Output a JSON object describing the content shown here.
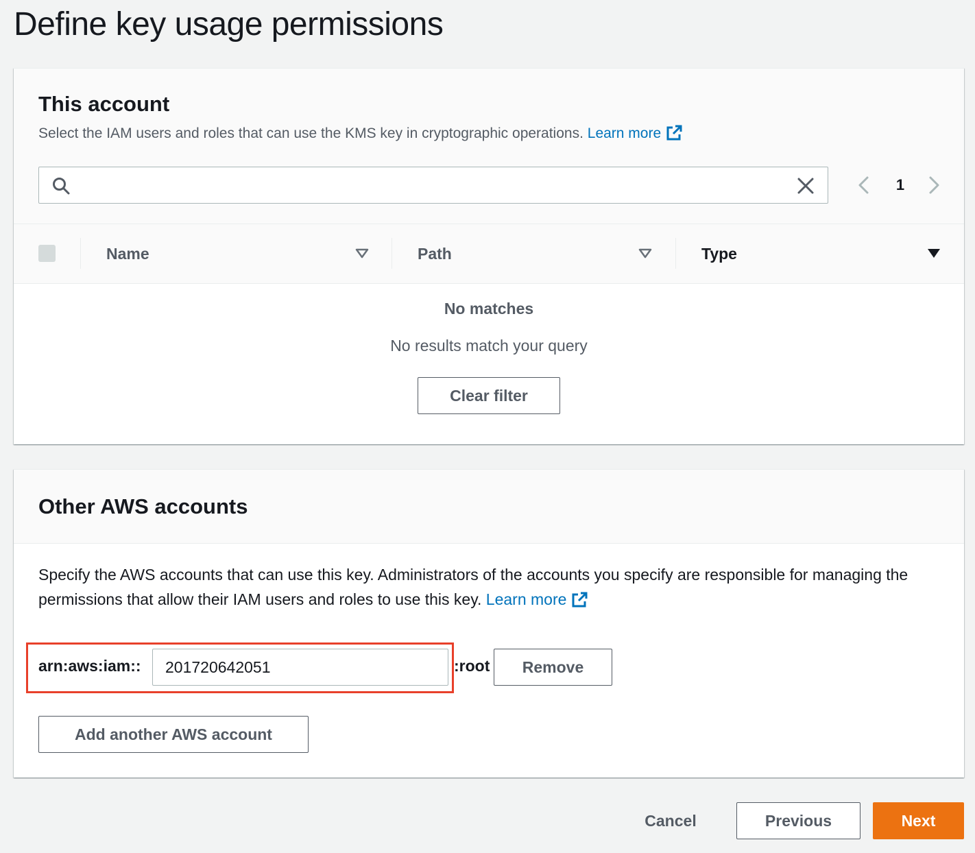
{
  "page": {
    "title": "Define key usage permissions"
  },
  "this_account": {
    "heading": "This account",
    "description": "Select the IAM users and roles that can use the KMS key in cryptographic operations.",
    "learn_more": "Learn more",
    "search": {
      "value": "",
      "placeholder": ""
    },
    "pagination": {
      "current_page": "1"
    },
    "table": {
      "columns": [
        {
          "label": "Name",
          "sorted": false
        },
        {
          "label": "Path",
          "sorted": false
        },
        {
          "label": "Type",
          "sorted": true
        }
      ],
      "empty_title": "No matches",
      "empty_message": "No results match your query",
      "clear_filter_label": "Clear filter"
    }
  },
  "other_accounts": {
    "heading": "Other AWS accounts",
    "description": "Specify the AWS accounts that can use this key. Administrators of the accounts you specify are responsible for managing the permissions that allow their IAM users and roles to use this key.",
    "learn_more": "Learn more",
    "arn_prefix": "arn:aws:iam::",
    "account_id": "201720642051",
    "arn_suffix": ":root",
    "remove_label": "Remove",
    "add_label": "Add another AWS account"
  },
  "footer": {
    "cancel_label": "Cancel",
    "previous_label": "Previous",
    "next_label": "Next"
  },
  "colors": {
    "primary_button": "#ec7211",
    "link": "#0073bb",
    "highlight": "#e8402a"
  }
}
